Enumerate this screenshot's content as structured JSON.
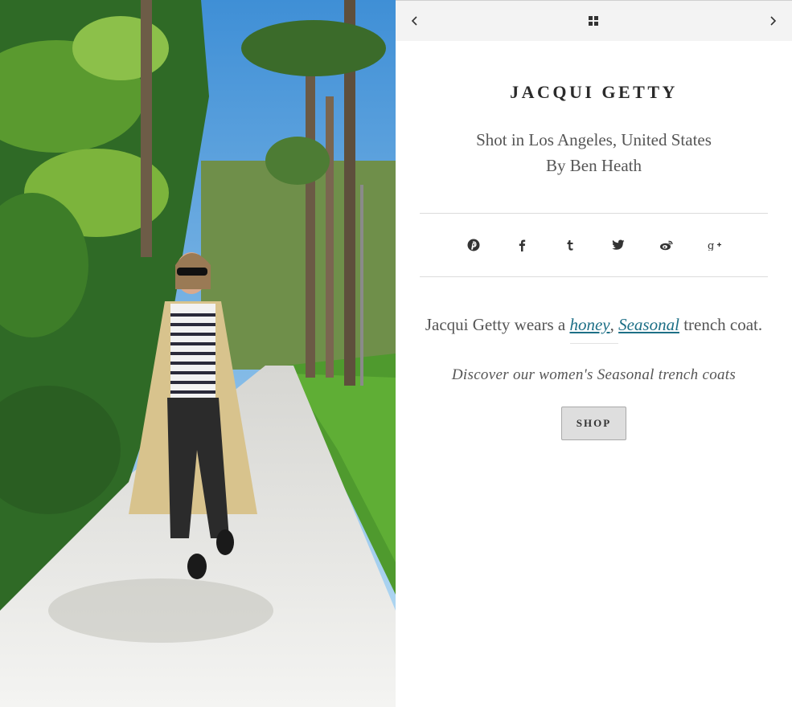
{
  "photo": {
    "alt_subject": "photo"
  },
  "nav": {
    "prev_icon": "chevron-left-icon",
    "grid_icon": "grid-icon",
    "next_icon": "chevron-right-icon"
  },
  "profile": {
    "name": "JACQUI GETTY",
    "location": "Shot in Los Angeles, United States",
    "byline": "By Ben Heath"
  },
  "social": [
    "pinterest-icon",
    "facebook-icon",
    "tumblr-icon",
    "twitter-icon",
    "weibo-icon",
    "google-plus-icon"
  ],
  "description": {
    "prefix": "Jacqui Getty wears a",
    "link1": "honey",
    "sep": ",",
    "link2": "Seasonal",
    "suffix": "trench coat."
  },
  "discover": "Discover our women's Seasonal trench coats",
  "shop_label": "SHOP",
  "colors": {
    "link": "#1d6f86",
    "navbar": "#f3f3f3",
    "button": "#dedede"
  }
}
